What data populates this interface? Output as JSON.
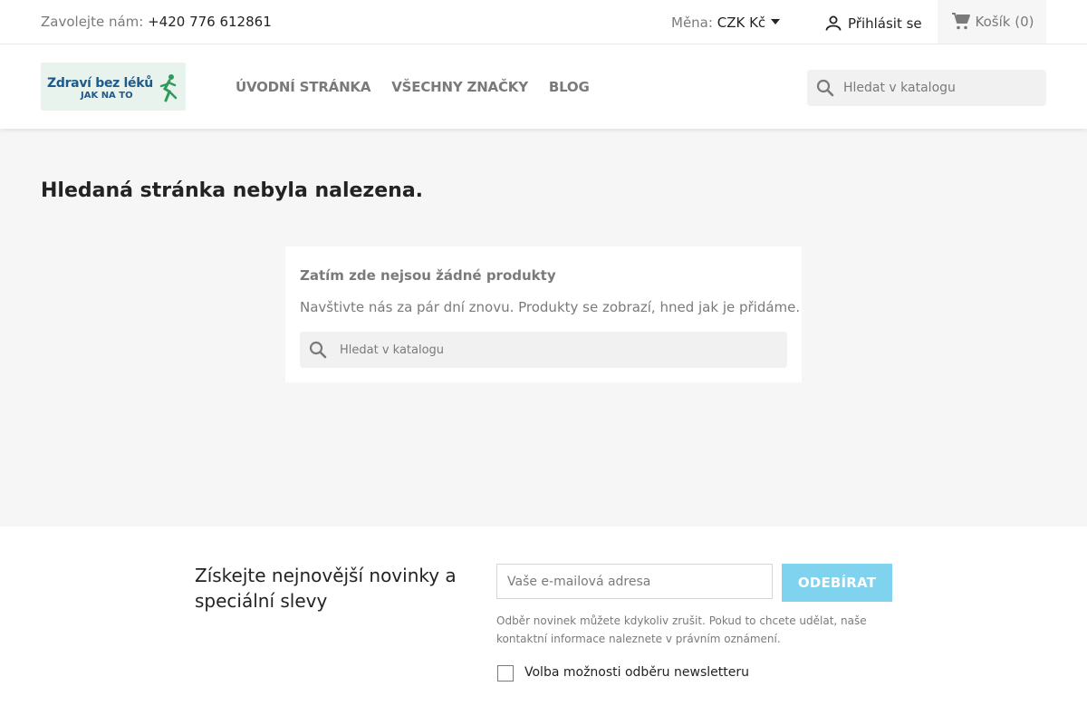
{
  "topbar": {
    "contact_label": "Zavolejte nám:",
    "phone": "+420 776 612861",
    "currency_label": "Měna:",
    "currency_value": "CZK Kč",
    "signin_label": "Přihlásit se",
    "cart_label": "Košík",
    "cart_count": "(0)"
  },
  "header": {
    "logo_line1": "Zdraví bez léků",
    "logo_line2": "JAK NA TO",
    "nav": [
      {
        "label": "ÚVODNÍ STRÁNKA"
      },
      {
        "label": "VŠECHNY ZNAČKY"
      },
      {
        "label": "BLOG"
      }
    ],
    "search_placeholder": "Hledat v katalogu"
  },
  "main": {
    "title": "Hledaná stránka nebyla nalezena.",
    "box_heading": "Zatím zde nejsou žádné produkty",
    "box_text": "Navštivte nás za pár dní znovu. Produkty se zobrazí, hned jak je přidáme.",
    "search_placeholder": "Hledat v katalogu"
  },
  "newsletter": {
    "title": "Získejte nejnovější novinky a speciální slevy",
    "email_placeholder": "Vaše e-mailová adresa",
    "button_label": "ODEBÍRAT",
    "note": "Odběr novinek můžete kdykoliv zrušit. Pokud to chcete udělat, naše kontaktní informace naleznete v právním oznámení.",
    "checkbox_label": "Volba možnosti odběru newsletteru"
  },
  "colors": {
    "accent_button": "#7fd3ee",
    "text_muted": "#7a7a7a",
    "text_dark": "#232323",
    "logo_blue": "#1e5a8a"
  },
  "icons": {
    "user": "person-icon",
    "cart": "shopping-cart-icon",
    "search": "magnifier-icon",
    "currency_dropdown": "caret-down-icon"
  }
}
